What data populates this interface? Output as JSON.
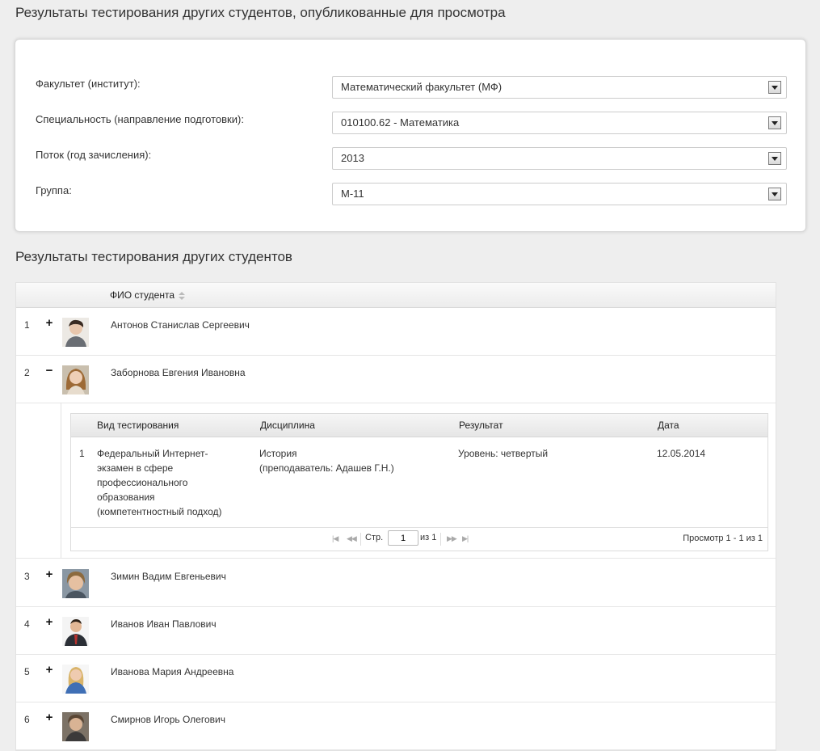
{
  "page": {
    "title": "Результаты тестирования других студентов, опубликованные для просмотра",
    "section_title": "Результаты тестирования других студентов"
  },
  "filters": [
    {
      "label": "Факультет (институт):",
      "value": "Математический факультет (МФ)"
    },
    {
      "label": "Специальность (направление подготовки):",
      "value": "010100.62 - Математика"
    },
    {
      "label": "Поток (год зачисления):",
      "value": "2013"
    },
    {
      "label": "Группа:",
      "value": "М-11"
    }
  ],
  "grid": {
    "column_fio": "ФИО студента",
    "rows": [
      {
        "num": "1",
        "expander": "+",
        "name": "Антонов Станислав Сергеевич",
        "avatar": "avatar-icon"
      },
      {
        "num": "2",
        "expander": "−",
        "name": "Заборнова Евгения Ивановна",
        "avatar": "avatar-icon"
      },
      {
        "num": "3",
        "expander": "+",
        "name": "Зимин Вадим Евгеньевич",
        "avatar": "avatar-icon"
      },
      {
        "num": "4",
        "expander": "+",
        "name": "Иванов Иван Павлович",
        "avatar": "avatar-icon"
      },
      {
        "num": "5",
        "expander": "+",
        "name": "Иванова Мария Андреевна",
        "avatar": "avatar-icon"
      },
      {
        "num": "6",
        "expander": "+",
        "name": "Смирнов Игорь Олегович",
        "avatar": "avatar-icon"
      }
    ]
  },
  "subgrid": {
    "headers": {
      "test_type": "Вид тестирования",
      "discipline": "Дисциплина",
      "result": "Результат",
      "date": "Дата"
    },
    "rows": [
      {
        "num": "1",
        "test_type": [
          "Федеральный Интернет-",
          "экзамен в сфере",
          "профессионального",
          "образования",
          "(компетентностный подход)"
        ],
        "discipline": [
          "История",
          "(преподаватель: Адашев Г.Н.)"
        ],
        "result": "Уровень: четвертый",
        "date": "12.05.2014"
      }
    ],
    "pager": {
      "page_label": "Стр.",
      "page_value": "1",
      "of_label": "из 1",
      "view_text": "Просмотр 1 - 1 из 1"
    }
  }
}
